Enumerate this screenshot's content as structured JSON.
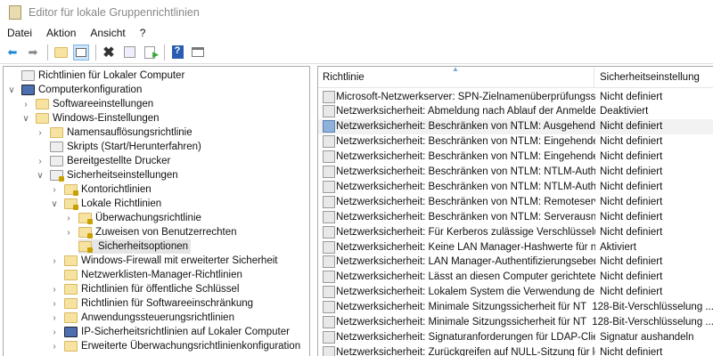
{
  "window": {
    "title": "Editor für lokale Gruppenrichtlinien"
  },
  "menu": [
    "Datei",
    "Aktion",
    "Ansicht",
    "?"
  ],
  "toolbar": {
    "back": "back-icon",
    "forward": "forward-icon",
    "up": "up-folder-icon",
    "show_hide": "show-hide-tree-icon",
    "delete": "delete-icon",
    "properties": "properties-icon",
    "export": "export-list-icon",
    "help": "help-icon",
    "console": "console-icon"
  },
  "tree": [
    {
      "label": "Richtlinien für Lokaler Computer",
      "level": 0,
      "chev": "",
      "icon": "doc"
    },
    {
      "label": "Computerkonfiguration",
      "level": 1,
      "chev": "open",
      "icon": "pc"
    },
    {
      "label": "Softwareeinstellungen",
      "level": 2,
      "chev": "closed",
      "icon": "folder"
    },
    {
      "label": "Windows-Einstellungen",
      "level": 2,
      "chev": "open",
      "icon": "folder"
    },
    {
      "label": "Namensauflösungsrichtlinie",
      "level": 3,
      "chev": "closed",
      "icon": "folder"
    },
    {
      "label": "Skripts (Start/Herunterfahren)",
      "level": 3,
      "chev": "",
      "icon": "doc"
    },
    {
      "label": "Bereitgestellte Drucker",
      "level": 3,
      "chev": "closed",
      "icon": "doc"
    },
    {
      "label": "Sicherheitseinstellungen",
      "level": 3,
      "chev": "open",
      "icon": "lockdoc"
    },
    {
      "label": "Kontorichtlinien",
      "level": 4,
      "chev": "closed",
      "icon": "lock"
    },
    {
      "label": "Lokale Richtlinien",
      "level": 4,
      "chev": "open",
      "icon": "lock"
    },
    {
      "label": "Überwachungsrichtlinie",
      "level": 5,
      "chev": "closed",
      "icon": "lock"
    },
    {
      "label": "Zuweisen von Benutzerrechten",
      "level": 5,
      "chev": "closed",
      "icon": "lock"
    },
    {
      "label": "Sicherheitsoptionen",
      "level": 5,
      "chev": "",
      "icon": "lock",
      "selected": true
    },
    {
      "label": "Windows-Firewall mit erweiterter Sicherheit",
      "level": 4,
      "chev": "closed",
      "icon": "folder"
    },
    {
      "label": "Netzwerklisten-Manager-Richtlinien",
      "level": 4,
      "chev": "",
      "icon": "folder"
    },
    {
      "label": "Richtlinien für öffentliche Schlüssel",
      "level": 4,
      "chev": "closed",
      "icon": "folder"
    },
    {
      "label": "Richtlinien für Softwareeinschränkung",
      "level": 4,
      "chev": "closed",
      "icon": "folder"
    },
    {
      "label": "Anwendungssteuerungsrichtlinien",
      "level": 4,
      "chev": "closed",
      "icon": "folder"
    },
    {
      "label": "IP-Sicherheitsrichtlinien auf Lokaler Computer",
      "level": 4,
      "chev": "closed",
      "icon": "pc"
    },
    {
      "label": "Erweiterte Überwachungsrichtlinienkonfiguration",
      "level": 4,
      "chev": "closed",
      "icon": "folder"
    }
  ],
  "table": {
    "columns": [
      "Richtlinie",
      "Sicherheitseinstellung"
    ],
    "rows": [
      [
        "Microsoft-Netzwerkserver: SPN-Zielnamenüberprüfungsstuf...",
        "Nicht definiert"
      ],
      [
        "Netzwerksicherheit: Abmeldung nach Ablauf der Anmeldez...",
        "Deaktiviert"
      ],
      [
        "Netzwerksicherheit: Beschränken von NTLM: Ausgehender ...",
        "Nicht definiert"
      ],
      [
        "Netzwerksicherheit: Beschränken von NTLM: Eingehenden ...",
        "Nicht definiert"
      ],
      [
        "Netzwerksicherheit: Beschränken von NTLM: Eingehender N...",
        "Nicht definiert"
      ],
      [
        "Netzwerksicherheit: Beschränken von NTLM: NTLM-Authen...",
        "Nicht definiert"
      ],
      [
        "Netzwerksicherheit: Beschränken von NTLM: NTLM-Authen...",
        "Nicht definiert"
      ],
      [
        "Netzwerksicherheit: Beschränken von NTLM: Remoteservera...",
        "Nicht definiert"
      ],
      [
        "Netzwerksicherheit: Beschränken von NTLM: Serverausnah...",
        "Nicht definiert"
      ],
      [
        "Netzwerksicherheit: Für Kerberos zulässige Verschlüsselungs...",
        "Nicht definiert"
      ],
      [
        "Netzwerksicherheit: Keine LAN Manager-Hashwerte für näc...",
        "Aktiviert"
      ],
      [
        "Netzwerksicherheit: LAN Manager-Authentifizierungsebene",
        "Nicht definiert"
      ],
      [
        "Netzwerksicherheit: Lässt an diesen Computer gerichtete PK...",
        "Nicht definiert"
      ],
      [
        "Netzwerksicherheit: Lokalem System die Verwendung der C...",
        "Nicht definiert"
      ],
      [
        "Netzwerksicherheit: Minimale Sitzungssicherheit für NTLM-...",
        "128-Bit-Verschlüsselung ..."
      ],
      [
        "Netzwerksicherheit: Minimale Sitzungssicherheit für NTLM-...",
        "128-Bit-Verschlüsselung ..."
      ],
      [
        "Netzwerksicherheit: Signaturanforderungen für LDAP-Clients",
        "Signatur aushandeln"
      ],
      [
        "Netzwerksicherheit: Zurückgreifen auf NULL-Sitzung für lok...",
        "Nicht definiert"
      ]
    ],
    "highlighted_row": 2
  }
}
